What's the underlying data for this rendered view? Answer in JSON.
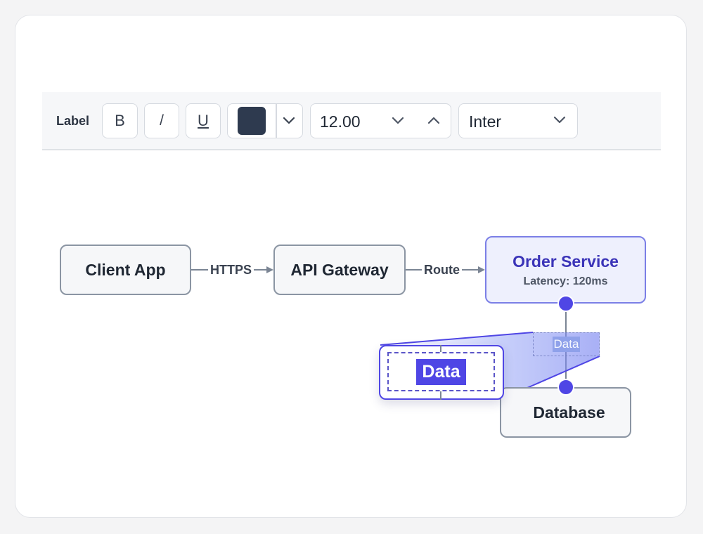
{
  "toolbar": {
    "label": "Label",
    "bold_label": "B",
    "italic_label": "/",
    "underline_label": "U",
    "color": "#2e3a4f",
    "font_size": "12.00",
    "font_family": "Inter"
  },
  "diagram": {
    "nodes": {
      "client": "Client App",
      "gateway": "API Gateway",
      "order": "Order Service",
      "order_sub": "Latency: 120ms",
      "database": "Database"
    },
    "edges": {
      "https": "HTTPS",
      "route": "Route",
      "data": "Data"
    },
    "zoom_text": "Data"
  },
  "colors": {
    "accent": "#4f46e5",
    "node_border": "#8b95a3",
    "selected_border": "#7b7fe6"
  }
}
